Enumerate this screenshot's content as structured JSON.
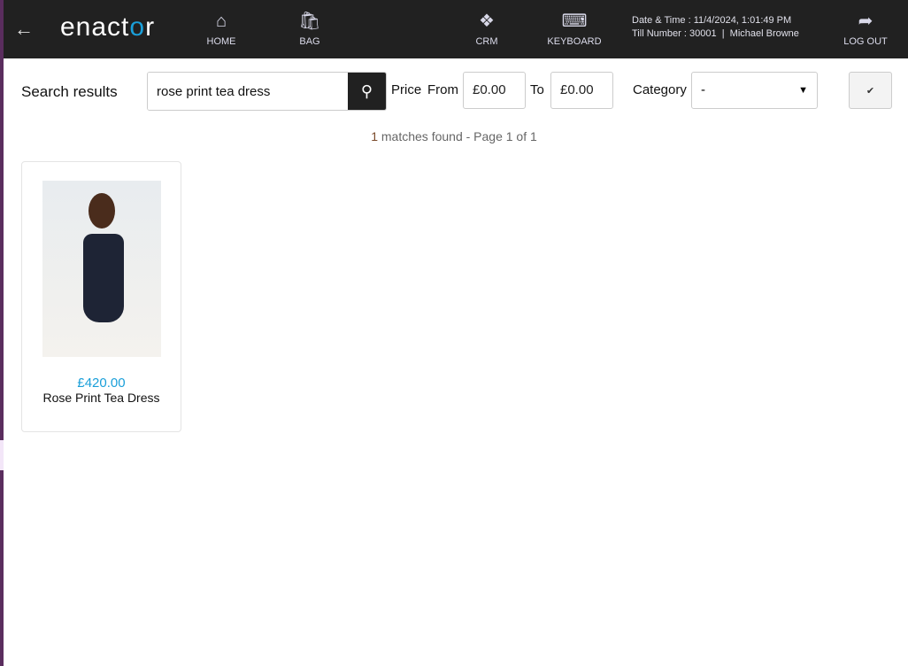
{
  "header": {
    "logo": "enactor",
    "nav": [
      {
        "label": "HOME",
        "icon": "home-icon"
      },
      {
        "label": "BAG",
        "icon": "bag-icon"
      },
      {
        "label": "CRM",
        "icon": "people-icon"
      },
      {
        "label": "KEYBOARD",
        "icon": "keyboard-icon"
      },
      {
        "label": "LOG OUT",
        "icon": "logout-icon"
      }
    ],
    "datetime": "Date & Time : 11/4/2024, 1:01:49 PM",
    "till": "Till Number : 30001  |  Michael Browne"
  },
  "search": {
    "title": "Search results",
    "value": "rose print tea dress",
    "price_label": "Price",
    "from_label": "From",
    "from_value": "£0.00",
    "to_label": "To",
    "to_value": "£0.00",
    "category_label": "Category",
    "category_value": "-"
  },
  "results": {
    "count": "1",
    "summary": " matches found - Page 1 of 1",
    "items": [
      {
        "price": "£420.00",
        "name": "Rose Print Tea Dress"
      }
    ]
  },
  "colors": {
    "accent": "#1a9fd9",
    "topbar": "#212121"
  }
}
